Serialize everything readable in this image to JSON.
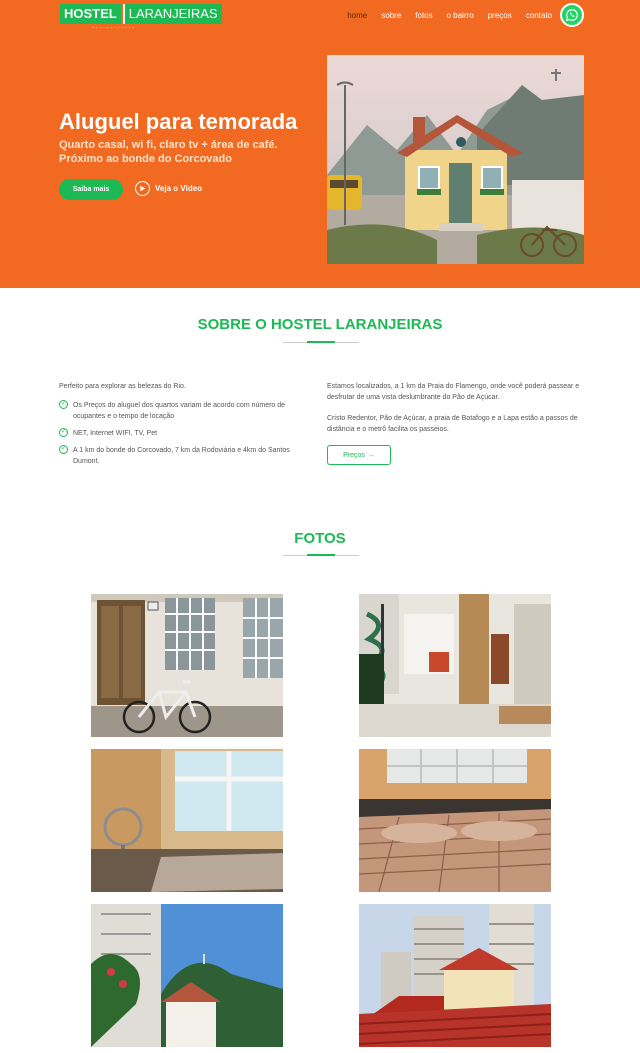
{
  "header": {
    "logo_word1": "HOSTEL",
    "logo_word2": "LARANJEIRAS",
    "nav": [
      "home",
      "sobre",
      "fotos",
      "o bairro",
      "preços",
      "contato"
    ],
    "whatsapp_icon": "whatsapp-icon"
  },
  "hero": {
    "title": "Aluguel para temorada",
    "subtitle": "Quarto casal, wi fi, claro tv + área de café. Próximo ao bonde do Corcovado",
    "primary_button": "Saiba mais",
    "video_link": "Veja o Vídeo"
  },
  "about": {
    "title": "SOBRE O HOSTEL LARANJEIRAS",
    "intro": "Perfeito para explorar as belezas do Rio.",
    "features": [
      "Os Preços do aluguel dos quartos variam de acordo com número de ocupantes e o tempo de locação",
      "NET, Internet WIFI, TV, Pet",
      "A 1 km do bonde do Corcovado, 7 km da Rodoviária e 4km do Santos Dumont."
    ],
    "para1": "Estamos localizados, a 1 km da Praia do Flamengo, onde você poderá passear e desfrutar de uma vista deslumbrante do Pão de Açúcar.",
    "para2": "Cristo Redentor, Pão de Açúcar, a praia de Botafogo e a Lapa estão a passos de distância e o metrô facilita os passeios.",
    "button": "Preços"
  },
  "photos": {
    "title": "FOTOS"
  },
  "colors": {
    "orange": "#f26a21",
    "green": "#1db954"
  }
}
